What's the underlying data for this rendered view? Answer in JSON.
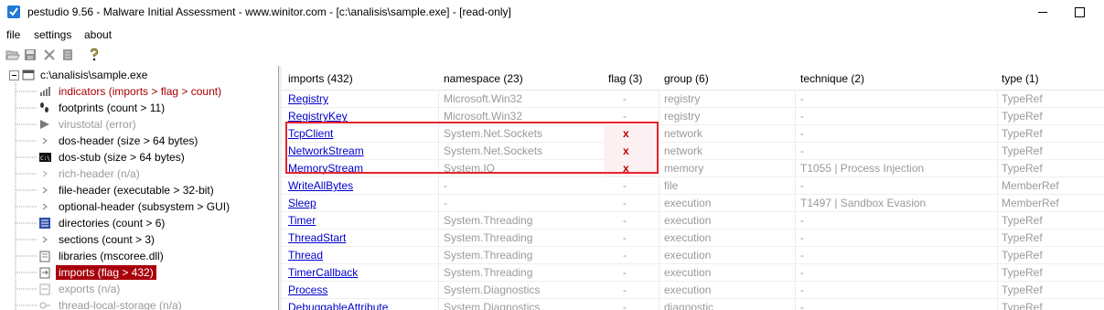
{
  "window": {
    "title": "pestudio 9.56 - Malware Initial Assessment - www.winitor.com - [c:\\analisis\\sample.exe] - [read-only]"
  },
  "menu": [
    {
      "label": "file"
    },
    {
      "label": "settings"
    },
    {
      "label": "about"
    }
  ],
  "toolbar": {
    "icons": [
      "open-icon",
      "save-icon",
      "close-icon",
      "document-icon",
      "help-icon"
    ]
  },
  "tree": {
    "items": [
      {
        "label": "c:\\analisis\\sample.exe",
        "style": "normal",
        "icon": "file-icon"
      },
      {
        "label": "indicators (imports > flag > count)",
        "style": "red",
        "icon": "indicators-icon"
      },
      {
        "label": "footprints (count > 11)",
        "style": "normal",
        "icon": "footprints-icon"
      },
      {
        "label": "virustotal (error)",
        "style": "grey",
        "icon": "virustotal-icon"
      },
      {
        "label": "dos-header (size > 64 bytes)",
        "style": "normal",
        "icon": "triangle-icon"
      },
      {
        "label": "dos-stub (size > 64 bytes)",
        "style": "normal",
        "icon": "console-icon"
      },
      {
        "label": "rich-header (n/a)",
        "style": "grey",
        "icon": "triangle-icon"
      },
      {
        "label": "file-header (executable > 32-bit)",
        "style": "normal",
        "icon": "triangle-icon"
      },
      {
        "label": "optional-header (subsystem > GUI)",
        "style": "normal",
        "icon": "triangle-icon"
      },
      {
        "label": "directories (count > 6)",
        "style": "normal",
        "icon": "directories-icon"
      },
      {
        "label": "sections (count > 3)",
        "style": "normal",
        "icon": "triangle-icon"
      },
      {
        "label": "libraries (mscoree.dll)",
        "style": "normal",
        "icon": "library-icon"
      },
      {
        "label": "imports (flag > 432)",
        "style": "selected",
        "icon": "imports-icon"
      },
      {
        "label": "exports (n/a)",
        "style": "grey",
        "icon": "exports-icon"
      },
      {
        "label": "thread-local-storage (n/a)",
        "style": "grey",
        "icon": "tls-icon"
      }
    ]
  },
  "table": {
    "columns": [
      {
        "label": "imports (432)"
      },
      {
        "label": "namespace (23)"
      },
      {
        "label": "flag (3)"
      },
      {
        "label": "group (6)"
      },
      {
        "label": "technique (2)"
      },
      {
        "label": "type (1)"
      }
    ],
    "rows": [
      {
        "import": "Registry",
        "namespace": "Microsoft.Win32",
        "flag": "-",
        "group": "registry",
        "technique": "-",
        "type": "TypeRef"
      },
      {
        "import": "RegistryKey",
        "namespace": "Microsoft.Win32",
        "flag": "-",
        "group": "registry",
        "technique": "-",
        "type": "TypeRef"
      },
      {
        "import": "TcpClient",
        "namespace": "System.Net.Sockets",
        "flag": "x",
        "group": "network",
        "technique": "-",
        "type": "TypeRef"
      },
      {
        "import": "NetworkStream",
        "namespace": "System.Net.Sockets",
        "flag": "x",
        "group": "network",
        "technique": "-",
        "type": "TypeRef"
      },
      {
        "import": "MemoryStream",
        "namespace": "System.IO",
        "flag": "x",
        "group": "memory",
        "technique": "T1055 | Process Injection",
        "type": "TypeRef"
      },
      {
        "import": "WriteAllBytes",
        "namespace": "-",
        "flag": "-",
        "group": "file",
        "technique": "-",
        "type": "MemberRef"
      },
      {
        "import": "Sleep",
        "namespace": "-",
        "flag": "-",
        "group": "execution",
        "technique": "T1497 | Sandbox Evasion",
        "type": "MemberRef"
      },
      {
        "import": "Timer",
        "namespace": "System.Threading",
        "flag": "-",
        "group": "execution",
        "technique": "-",
        "type": "TypeRef"
      },
      {
        "import": "ThreadStart",
        "namespace": "System.Threading",
        "flag": "-",
        "group": "execution",
        "technique": "-",
        "type": "TypeRef"
      },
      {
        "import": "Thread",
        "namespace": "System.Threading",
        "flag": "-",
        "group": "execution",
        "technique": "-",
        "type": "TypeRef"
      },
      {
        "import": "TimerCallback",
        "namespace": "System.Threading",
        "flag": "-",
        "group": "execution",
        "technique": "-",
        "type": "TypeRef"
      },
      {
        "import": "Process",
        "namespace": "System.Diagnostics",
        "flag": "-",
        "group": "execution",
        "technique": "-",
        "type": "TypeRef"
      },
      {
        "import": "DebuggableAttribute",
        "namespace": "System.Diagnostics",
        "flag": "-",
        "group": "diagnostic",
        "technique": "-",
        "type": "TypeRef"
      }
    ]
  },
  "colors": {
    "selection": "#a8000b",
    "indicator_text": "#a80000",
    "link": "#0000cc",
    "flag_x": "#c00000",
    "highlight_box": "#e8242a"
  }
}
